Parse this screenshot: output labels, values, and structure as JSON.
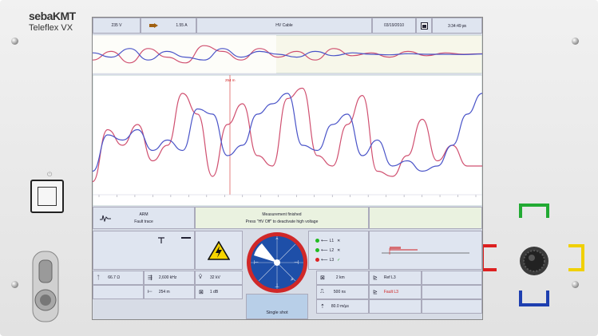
{
  "brand": {
    "logo": "sebaKMT",
    "model": "Teleflex VX"
  },
  "power_symbol": "⏻",
  "header": {
    "voltage": "235 V",
    "current": "1.55 A",
    "mode": "HV Cable",
    "date": "03/19/2010",
    "time": "3:34:49 ㏘"
  },
  "cursor_label": "254 m",
  "x_tick_labels": [
    "",
    "",
    "",
    "",
    "",
    "",
    "",
    "",
    "",
    "",
    "",
    "",
    "",
    "",
    "",
    "",
    "",
    "",
    "",
    "",
    "",
    ""
  ],
  "arm": {
    "title": "ARM",
    "subtitle": "Fault trace"
  },
  "status": {
    "line1": "Measurement finished",
    "line2": "Press \"HV Off\" to deactivate high voltage"
  },
  "phases": [
    {
      "label": "L1",
      "state": "✕"
    },
    {
      "label": "L2",
      "state": "✕"
    },
    {
      "label": "L3",
      "state": "✓"
    }
  ],
  "values": {
    "resistance": "66.7 Ω",
    "frequency": "2,600 kHz",
    "hv": "32 kV",
    "distance": "254 m",
    "gain": "1 dB",
    "range": "2 km",
    "pulse": "500 ns",
    "velocity": "80.0 m/µs",
    "ref": "Ref L3",
    "fault": "Fault L3"
  },
  "single_shot": "Single shot",
  "colors": {
    "ref_trace": "#d05070",
    "fault_trace": "#4a54c8",
    "cursor": "#e06060",
    "panel_bg": "#dfe5f0",
    "fault_text": "#d02020",
    "wheel_red": "#d02828",
    "wheel_blue": "#1e4fa8"
  },
  "overview_chart": {
    "series": [
      {
        "color": "#d05070",
        "values": [
          30,
          60,
          20,
          70,
          40,
          20,
          80,
          60,
          30,
          70,
          40,
          60,
          30,
          70,
          45,
          55,
          40,
          60,
          45,
          55,
          50,
          52
        ]
      },
      {
        "color": "#4a54c8",
        "values": [
          55,
          40,
          70,
          30,
          60,
          40,
          30,
          70,
          40,
          60,
          50,
          40,
          60,
          45,
          55,
          50,
          48,
          52,
          50,
          50,
          49,
          51
        ]
      }
    ]
  },
  "main_chart": {
    "series": [
      {
        "name": "",
        "color": "#d05070",
        "values": [
          5,
          55,
          40,
          60,
          25,
          40,
          90,
          70,
          10,
          60,
          80,
          30,
          20,
          85,
          95,
          30,
          20,
          60,
          88,
          15,
          10,
          30,
          65,
          25,
          40,
          20,
          20
        ]
      },
      {
        "name": "",
        "color": "#4a54c8",
        "values": [
          15,
          50,
          45,
          55,
          35,
          45,
          35,
          75,
          70,
          30,
          40,
          70,
          80,
          90,
          40,
          35,
          60,
          70,
          30,
          45,
          20,
          25,
          15,
          20,
          40,
          70,
          90
        ]
      }
    ]
  }
}
